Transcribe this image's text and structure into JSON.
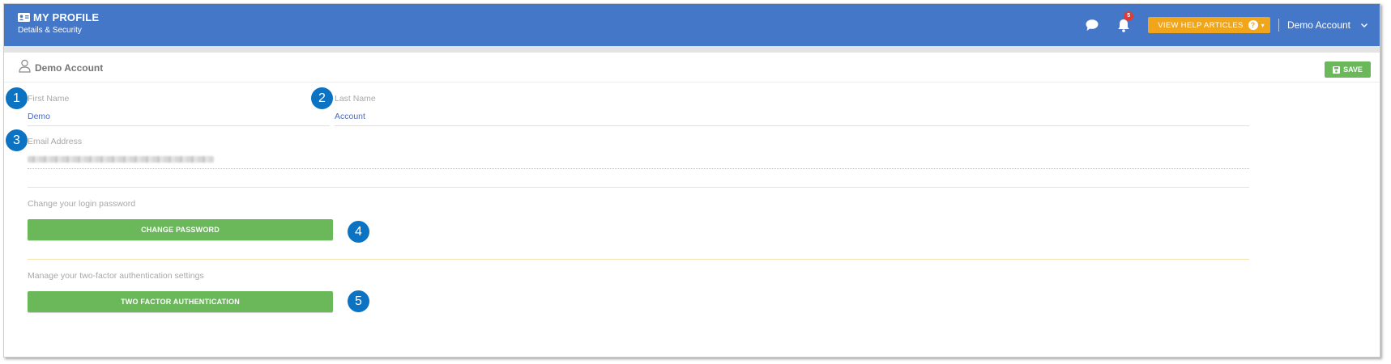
{
  "header": {
    "title": "MY PROFILE",
    "subtitle": "Details & Security",
    "notification_count": "5",
    "help_button_label": "VIEW HELP ARTICLES",
    "help_icon": "?",
    "account_name": "Demo Account"
  },
  "panel": {
    "title": "Demo Account",
    "save_label": "SAVE"
  },
  "form": {
    "first_name_label": "First Name",
    "first_name_value": "Demo",
    "last_name_label": "Last Name",
    "last_name_value": "Account",
    "email_label": "Email Address"
  },
  "security": {
    "password_text": "Change your login password",
    "password_button": "CHANGE PASSWORD",
    "twofa_text": "Manage your two-factor authentication settings",
    "twofa_button": "TWO FACTOR AUTHENTICATION"
  },
  "callouts": [
    "1",
    "2",
    "3",
    "4",
    "5"
  ],
  "colors": {
    "header_bg": "#4577c8",
    "help_button": "#f0a51a",
    "action_green": "#6bb85b",
    "callout_blue": "#0c72c2",
    "badge_red": "#e03b3b"
  }
}
